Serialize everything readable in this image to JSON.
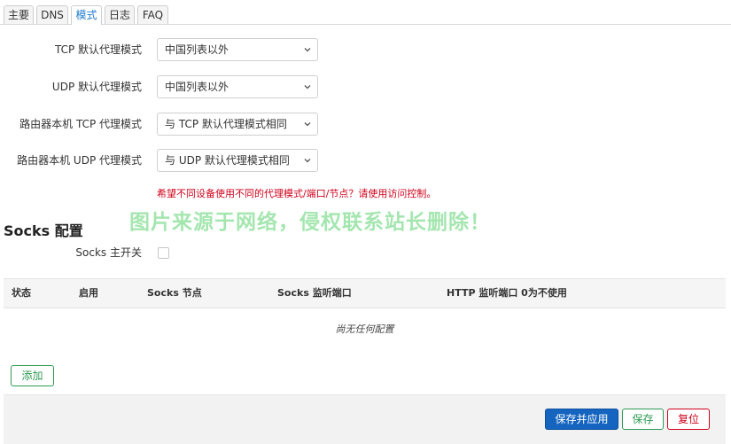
{
  "tabs": [
    {
      "label": "主要",
      "active": false
    },
    {
      "label": "DNS",
      "active": false
    },
    {
      "label": "模式",
      "active": true
    },
    {
      "label": "日志",
      "active": false
    },
    {
      "label": "FAQ",
      "active": false
    }
  ],
  "mode_settings": [
    {
      "label": "TCP 默认代理模式",
      "value": "中国列表以外"
    },
    {
      "label": "UDP 默认代理模式",
      "value": "中国列表以外"
    },
    {
      "label": "路由器本机 TCP 代理模式",
      "value": "与 TCP 默认代理模式相同"
    },
    {
      "label": "路由器本机 UDP 代理模式",
      "value": "与 UDP 默认代理模式相同"
    }
  ],
  "warning": "希望不同设备使用不同的代理模式/端口/节点？请使用访问控制。",
  "watermark": "图片来源于网络，侵权联系站长删除！",
  "socks": {
    "title": "Socks 配置",
    "master_switch_label": "Socks 主开关",
    "master_switch_checked": false,
    "columns": [
      "状态",
      "启用",
      "Socks 节点",
      "Socks 监听端口",
      "HTTP 监听端口 0为不使用"
    ],
    "empty_text": "尚无任何配置",
    "add_label": "添加"
  },
  "footer": {
    "apply_label": "保存并应用",
    "save_label": "保存",
    "reset_label": "复位"
  },
  "colors": {
    "active_tab": "#1f7bd0",
    "warning": "#d0021b",
    "primary": "#1565c0",
    "success": "#2e9b54",
    "danger": "#d0021b",
    "watermark": "#5ad26e"
  }
}
